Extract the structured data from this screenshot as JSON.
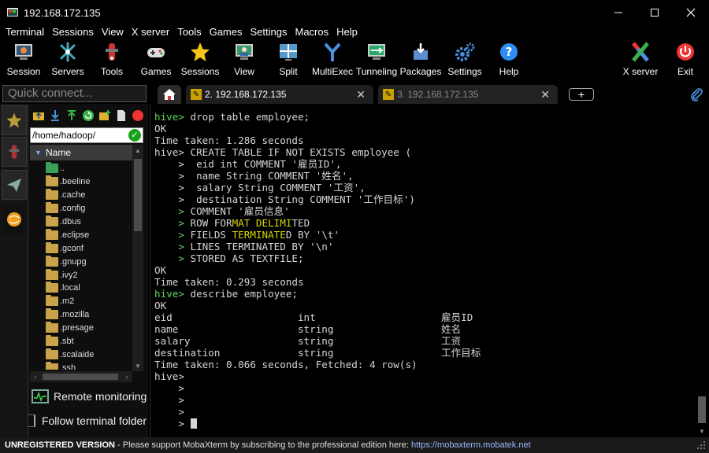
{
  "window": {
    "title": "192.168.172.135",
    "minimize": "—",
    "maximize": "☐",
    "close": "✕"
  },
  "menu": [
    "Terminal",
    "Sessions",
    "View",
    "X server",
    "Tools",
    "Games",
    "Settings",
    "Macros",
    "Help"
  ],
  "toolbar": {
    "items": [
      {
        "label": "Session",
        "icon": "session-icon"
      },
      {
        "label": "Servers",
        "icon": "servers-icon"
      },
      {
        "label": "Tools",
        "icon": "tools-icon"
      },
      {
        "label": "Games",
        "icon": "games-icon"
      },
      {
        "label": "Sessions",
        "icon": "sessions-star-icon"
      },
      {
        "label": "View",
        "icon": "view-icon"
      },
      {
        "label": "Split",
        "icon": "split-icon"
      },
      {
        "label": "MultiExec",
        "icon": "multiexec-icon"
      },
      {
        "label": "Tunneling",
        "icon": "tunneling-icon"
      },
      {
        "label": "Packages",
        "icon": "packages-icon"
      },
      {
        "label": "Settings",
        "icon": "settings-gear-icon"
      },
      {
        "label": "Help",
        "icon": "help-icon"
      }
    ],
    "xserver_label": "X server",
    "exit_label": "Exit"
  },
  "quick_connect": {
    "placeholder": "Quick connect..."
  },
  "tabs": {
    "active_label": "2. 192.168.172.135",
    "inactive_label": "3. 192.168.172.135",
    "close_glyph": "✕",
    "new_tab_glyph": "+"
  },
  "sidebar": {
    "path": "/home/hadoop/",
    "path_ok_glyph": "✓",
    "tree_header": "Name",
    "files": [
      "..",
      ".beeline",
      ".cache",
      ".config",
      ".dbus",
      ".eclipse",
      ".gconf",
      ".gnupg",
      ".ivy2",
      ".local",
      ".m2",
      ".mozilla",
      ".presage",
      ".sbt",
      ".scalaide",
      ".ssh"
    ],
    "remote_monitoring": "Remote monitoring",
    "follow_terminal": "Follow terminal folder"
  },
  "terminal": {
    "lines": [
      [
        [
          "hive> ",
          "g"
        ],
        [
          "drop table employee;",
          ""
        ]
      ],
      [
        [
          "OK",
          ""
        ]
      ],
      [
        [
          "Time taken: 1.286 seconds",
          ""
        ]
      ],
      [
        [
          "hive> CREATE TABLE IF NOT EXISTS employee (",
          ""
        ]
      ],
      [
        [
          "    >  eid int COMMENT '雇员ID',",
          ""
        ]
      ],
      [
        [
          "    >  name String COMMENT '姓名',",
          ""
        ]
      ],
      [
        [
          "    >  salary String COMMENT '工资',",
          ""
        ]
      ],
      [
        [
          "    >  destination String COMMENT '工作目标')",
          ""
        ]
      ],
      [
        [
          "    > ",
          "g"
        ],
        [
          "COMMENT '雇员信息'",
          ""
        ]
      ],
      [
        [
          "    > ",
          "g"
        ],
        [
          "ROW FOR",
          ""
        ],
        [
          "MAT DELIMI",
          "y"
        ],
        [
          "TED",
          ""
        ]
      ],
      [
        [
          "    > ",
          "g"
        ],
        [
          "FIELDS ",
          ""
        ],
        [
          "TERMINATE",
          "y"
        ],
        [
          "D BY '\\t'",
          ""
        ]
      ],
      [
        [
          "    > ",
          "g"
        ],
        [
          "LINES TERMINATED BY '\\n'",
          ""
        ]
      ],
      [
        [
          "    > ",
          "g"
        ],
        [
          "STORED AS TEXTFILE;",
          ""
        ]
      ],
      [
        [
          "OK",
          ""
        ]
      ],
      [
        [
          "Time taken: 0.293 seconds",
          ""
        ]
      ],
      [
        [
          "hive> ",
          "g"
        ],
        [
          "describe employee;",
          ""
        ]
      ],
      [
        [
          "OK",
          ""
        ]
      ],
      [
        [
          "eid                     int                     雇员ID",
          ""
        ]
      ],
      [
        [
          "name                    string                  姓名",
          ""
        ]
      ],
      [
        [
          "salary                  string                  工资",
          ""
        ]
      ],
      [
        [
          "destination             string                  工作目标",
          ""
        ]
      ],
      [
        [
          "Time taken: 0.066 seconds, Fetched: 4 row(s)",
          ""
        ]
      ],
      [
        [
          "hive>",
          ""
        ]
      ],
      [
        [
          "    >",
          ""
        ]
      ],
      [
        [
          "    >",
          ""
        ]
      ],
      [
        [
          "    >",
          ""
        ]
      ],
      [
        [
          "    > ",
          ""
        ]
      ]
    ]
  },
  "status": {
    "unregistered": "UNREGISTERED VERSION",
    "message": "  -  Please support MobaXterm by subscribing to the professional edition here:  ",
    "link": "https://mobaxterm.mobatek.net"
  },
  "colors": {
    "prompt_green": "#5fd75f",
    "highlight_yellow": "#d7d700",
    "tab_active": "#1e1e1e"
  }
}
